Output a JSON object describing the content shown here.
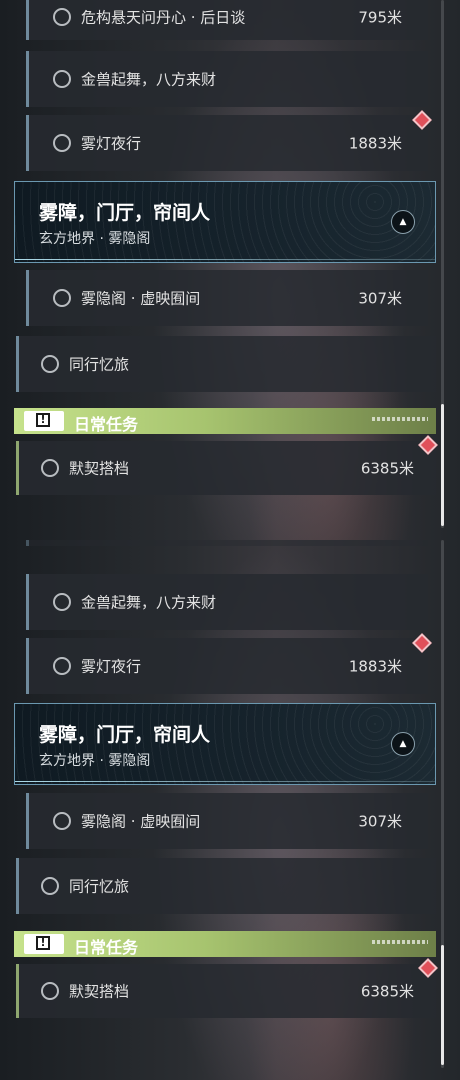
{
  "top": {
    "quests": [
      {
        "label": "危构悬天问丹心 · 后日谈",
        "distance": "795米"
      },
      {
        "label": "金兽起舞，八方来财",
        "distance": ""
      },
      {
        "label": "雾灯夜行",
        "distance": "1883米"
      }
    ],
    "header": {
      "title": "雾障，门厅，帘间人",
      "subtitle": "玄方地界 · 雾隐阁"
    },
    "sub_quest": {
      "label": "雾隐阁 · 虚映囿间",
      "distance": "307米"
    },
    "companion": {
      "label": "同行忆旅"
    },
    "daily": {
      "title": "日常任务",
      "icon": "exclamation-icon"
    },
    "daily_quest": {
      "label": "默契搭档",
      "distance": "6385米"
    }
  },
  "bottom": {
    "quests": [
      {
        "label": "金兽起舞，八方来财",
        "distance": ""
      },
      {
        "label": "雾灯夜行",
        "distance": "1883米"
      }
    ],
    "header": {
      "title": "雾障，门厅，帘间人",
      "subtitle": "玄方地界 · 雾隐阁"
    },
    "sub_quest": {
      "label": "雾隐阁 · 虚映囿间",
      "distance": "307米"
    },
    "companion": {
      "label": "同行忆旅"
    },
    "daily": {
      "title": "日常任务",
      "icon": "exclamation-icon"
    },
    "daily_quest": {
      "label": "默契搭档",
      "distance": "6385米"
    }
  },
  "colors": {
    "accent_bar": "#6f8a9c",
    "daily_green": "#c6e28c",
    "marker_red": "#e0505a"
  }
}
